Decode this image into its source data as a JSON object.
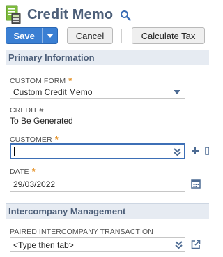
{
  "header": {
    "title": "Credit Memo",
    "doc_icon": "credit-memo-document-icon",
    "search_icon": "search-icon"
  },
  "toolbar": {
    "save_label": "Save",
    "cancel_label": "Cancel",
    "calculate_tax_label": "Calculate Tax"
  },
  "sections": {
    "primary": {
      "title": "Primary Information",
      "custom_form": {
        "label": "CUSTOM FORM",
        "required_mark": "*",
        "value": "Custom Credit Memo"
      },
      "credit_number": {
        "label": "CREDIT #",
        "value": "To Be Generated"
      },
      "customer": {
        "label": "CUSTOMER",
        "required_mark": "*",
        "value": ""
      },
      "date": {
        "label": "DATE",
        "required_mark": "*",
        "value": "29/03/2022"
      }
    },
    "intercompany": {
      "title": "Intercompany Management",
      "paired_transaction": {
        "label": "PAIRED INTERCOMPANY TRANSACTION",
        "value": "<Type then tab>"
      }
    }
  },
  "colors": {
    "accent": "#3a7fd3",
    "title": "#4d5f79",
    "section_bg": "#e6ebf2",
    "required": "#e38c1d"
  }
}
